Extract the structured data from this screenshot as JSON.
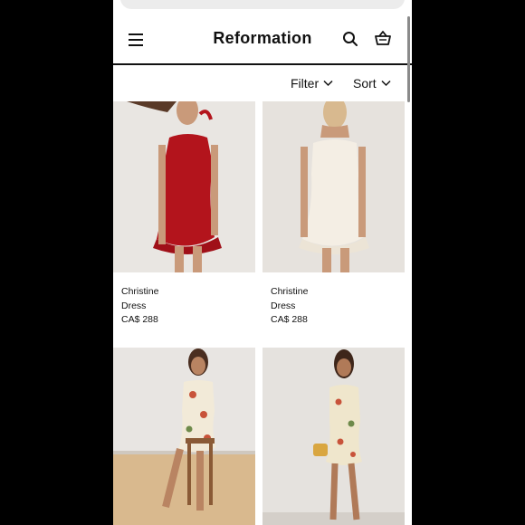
{
  "header": {
    "brand": "Reformation"
  },
  "toolbar": {
    "filter_label": "Filter",
    "sort_label": "Sort"
  },
  "products": [
    {
      "name": "Christine Dress",
      "price": "CA$ 288",
      "dress_color": "#b3141c",
      "bg_color": "#e9e6e2"
    },
    {
      "name": "Christine Dress",
      "price": "CA$ 288",
      "dress_color": "#f4eee4",
      "bg_color": "#e6e2dd"
    },
    {
      "name": "",
      "price": "",
      "dress_color": "#f2ead8",
      "bg_color": "#e8e5e2"
    },
    {
      "name": "",
      "price": "",
      "dress_color": "#efe6cc",
      "bg_color": "#e5e2de"
    }
  ],
  "icons": {
    "menu": "hamburger-menu-icon",
    "search": "search-icon",
    "bag": "shopping-bag-icon",
    "chevron": "chevron-down-icon"
  }
}
